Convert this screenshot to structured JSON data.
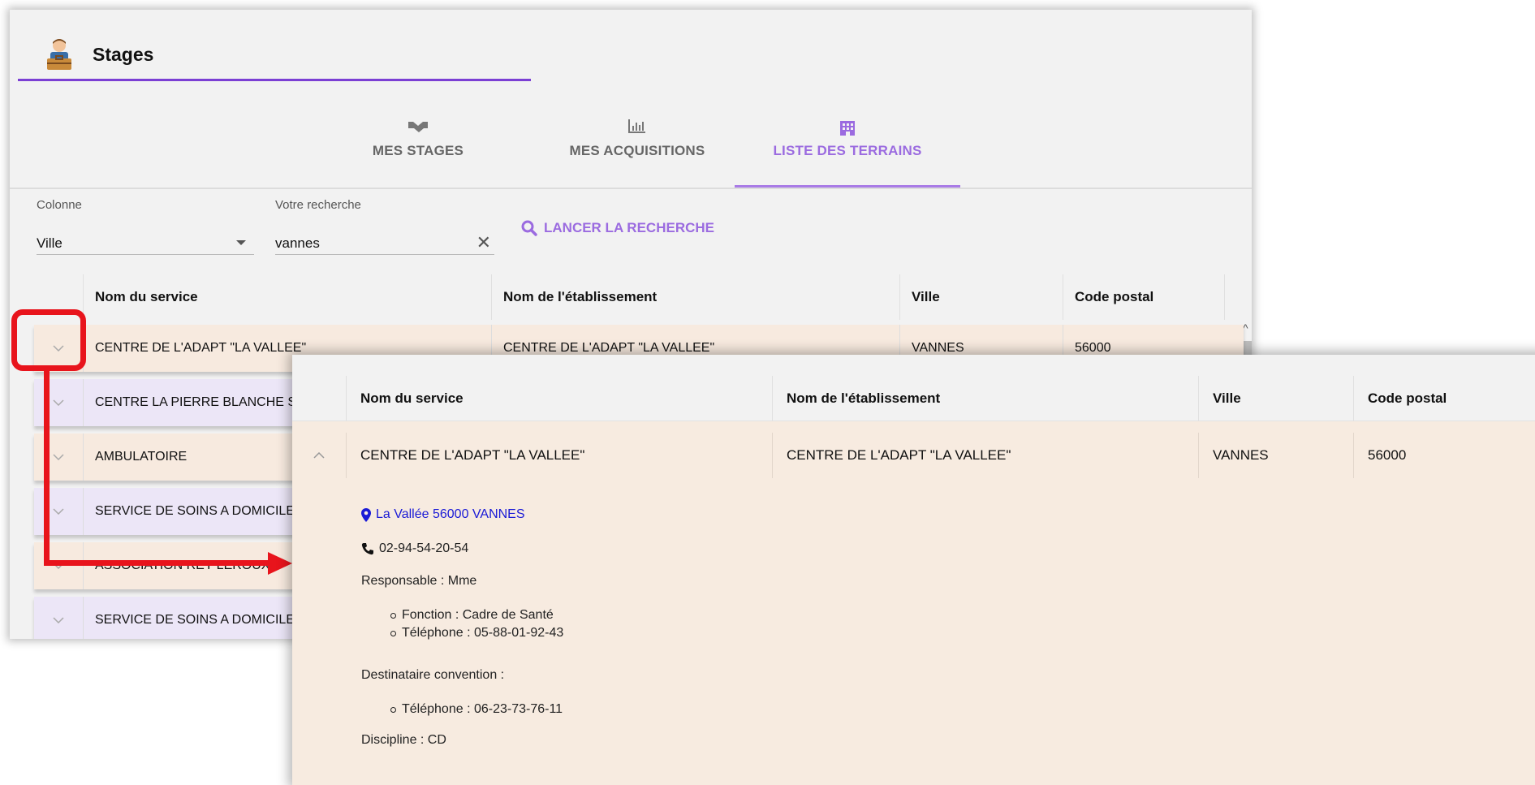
{
  "header": {
    "title": "Stages",
    "icon": "intern-briefcase-icon"
  },
  "tabs": [
    {
      "label": "MES STAGES",
      "icon": "handshake-icon"
    },
    {
      "label": "MES ACQUISITIONS",
      "icon": "bar-chart-icon"
    },
    {
      "label": "LISTE DES TERRAINS",
      "icon": "building-icon",
      "active": true
    }
  ],
  "search": {
    "column_label": "Colonne",
    "column_value": "Ville",
    "query_label": "Votre recherche",
    "query_value": "vannes",
    "button_label": "LANCER LA RECHERCHE"
  },
  "table": {
    "columns": [
      "Nom du service",
      "Nom de l'établissement",
      "Ville",
      "Code postal"
    ],
    "rows": [
      {
        "service": "CENTRE DE L'ADAPT \"LA VALLEE\"",
        "etablissement": "CENTRE DE L'ADAPT \"LA VALLEE\"",
        "ville": "VANNES",
        "code": "56000"
      },
      {
        "service": "CENTRE LA PIERRE BLANCHE S.S"
      },
      {
        "service": "AMBULATOIRE"
      },
      {
        "service": "SERVICE DE SOINS A DOMICILE ("
      },
      {
        "service": "ASSOCIATION REY LEROUX"
      },
      {
        "service": "SERVICE DE SOINS A DOMICILE"
      }
    ]
  },
  "detail": {
    "columns": [
      "Nom du service",
      "Nom de l'établissement",
      "Ville",
      "Code postal"
    ],
    "row": {
      "service": "CENTRE DE L'ADAPT \"LA VALLEE\"",
      "etablissement": "CENTRE DE L'ADAPT \"LA VALLEE\"",
      "ville": "VANNES",
      "code": "56000"
    },
    "address": "La Vallée 56000 VANNES",
    "phone": "02-94-54-20-54",
    "responsable": "Responsable : Mme",
    "responsable_items": [
      "Fonction : Cadre de Santé",
      "Téléphone : 05-88-01-92-43"
    ],
    "destinataire": "Destinataire convention :",
    "destinataire_items": [
      "Téléphone : 06-23-73-76-11"
    ],
    "discipline": "Discipline : CD"
  },
  "colors": {
    "accent": "#9b6be0",
    "underline": "#7b3fd4",
    "highlight": "#e8141c",
    "row_peach": "#f7eadf",
    "row_lavender": "#ece6f7",
    "link": "#1a1ad6"
  }
}
